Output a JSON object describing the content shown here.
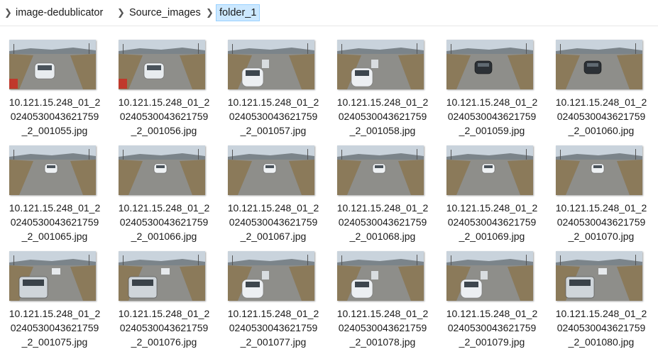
{
  "breadcrumb": {
    "items": [
      "image-dedublicator",
      "Source_images",
      "folder_1"
    ]
  },
  "files": [
    {
      "line1": "10.121.15.248_01_2",
      "line2": "0240530043621759",
      "line3": "_2_001055.jpg",
      "car": "white-suv"
    },
    {
      "line1": "10.121.15.248_01_2",
      "line2": "0240530043621759",
      "line3": "_2_001056.jpg",
      "car": "white-suv"
    },
    {
      "line1": "10.121.15.248_01_2",
      "line2": "0240530043621759",
      "line3": "_2_001057.jpg",
      "car": "white-sedan"
    },
    {
      "line1": "10.121.15.248_01_2",
      "line2": "0240530043621759",
      "line3": "_2_001058.jpg",
      "car": "white-sedan"
    },
    {
      "line1": "10.121.15.248_01_2",
      "line2": "0240530043621759",
      "line3": "_2_001059.jpg",
      "car": "dark-car"
    },
    {
      "line1": "10.121.15.248_01_2",
      "line2": "0240530043621759",
      "line3": "_2_001060.jpg",
      "car": "dark-car"
    },
    {
      "line1": "10.121.15.248_01_2",
      "line2": "0240530043621759",
      "line3": "_2_001065.jpg",
      "car": "white-small"
    },
    {
      "line1": "10.121.15.248_01_2",
      "line2": "0240530043621759",
      "line3": "_2_001066.jpg",
      "car": "white-small"
    },
    {
      "line1": "10.121.15.248_01_2",
      "line2": "0240530043621759",
      "line3": "_2_001067.jpg",
      "car": "white-small"
    },
    {
      "line1": "10.121.15.248_01_2",
      "line2": "0240530043621759",
      "line3": "_2_001068.jpg",
      "car": "white-small"
    },
    {
      "line1": "10.121.15.248_01_2",
      "line2": "0240530043621759",
      "line3": "_2_001069.jpg",
      "car": "white-small"
    },
    {
      "line1": "10.121.15.248_01_2",
      "line2": "0240530043621759",
      "line3": "_2_001070.jpg",
      "car": "white-small"
    },
    {
      "line1": "10.121.15.248_01_2",
      "line2": "0240530043621759",
      "line3": "_2_001075.jpg",
      "car": "silver-suv"
    },
    {
      "line1": "10.121.15.248_01_2",
      "line2": "0240530043621759",
      "line3": "_2_001076.jpg",
      "car": "silver-suv"
    },
    {
      "line1": "10.121.15.248_01_2",
      "line2": "0240530043621759",
      "line3": "_2_001077.jpg",
      "car": "white-sedan"
    },
    {
      "line1": "10.121.15.248_01_2",
      "line2": "0240530043621759",
      "line3": "_2_001078.jpg",
      "car": "white-sedan"
    },
    {
      "line1": "10.121.15.248_01_2",
      "line2": "0240530043621759",
      "line3": "_2_001079.jpg",
      "car": "white-sedan"
    },
    {
      "line1": "10.121.15.248_01_2",
      "line2": "0240530043621759",
      "line3": "_2_001080.jpg",
      "car": "silver-suv"
    }
  ],
  "colors": {
    "selected_bg": "#cce8ff",
    "selected_border": "#99d1ff",
    "sky": "#c9d3dc",
    "road": "#8e8e8a",
    "grass": "#8b7a5a"
  }
}
